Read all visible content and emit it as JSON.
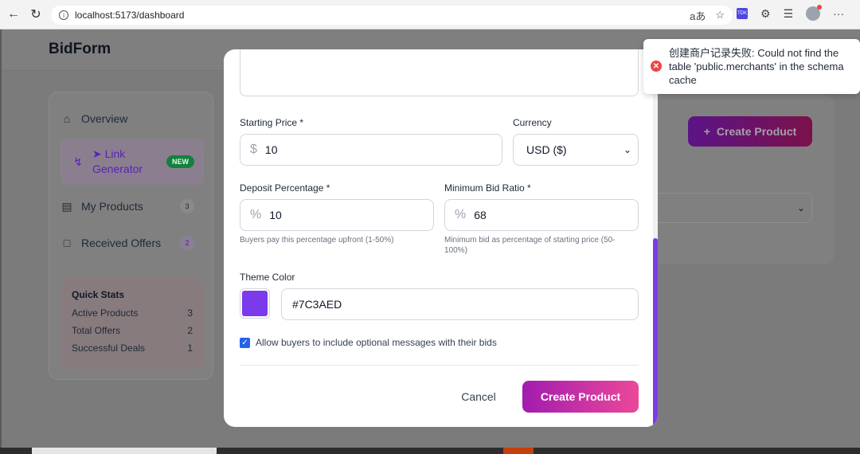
{
  "browser": {
    "url": "localhost:5173/dashboard",
    "read_aloud": "aあ",
    "ext_label": "TDK",
    "more": "···"
  },
  "app": {
    "brand": "BidForm"
  },
  "sidebar": {
    "items": [
      {
        "label": "Overview",
        "icon": "home-icon"
      },
      {
        "label": "Link Generator",
        "icon": "rocket-icon",
        "badge": "NEW",
        "active": true
      },
      {
        "label": "My Products",
        "icon": "document-icon",
        "count": "3"
      },
      {
        "label": "Received Offers",
        "icon": "chat-icon",
        "count": "2"
      }
    ],
    "link_line1": "Link",
    "link_line2": "Generator"
  },
  "quick_stats": {
    "title": "Quick Stats",
    "rows": [
      {
        "label": "Active Products",
        "value": "3"
      },
      {
        "label": "Total Offers",
        "value": "2"
      },
      {
        "label": "Successful Deals",
        "value": "1"
      }
    ]
  },
  "background": {
    "create_button": "Create Product"
  },
  "modal": {
    "starting_price": {
      "label": "Starting Price *",
      "prefix": "$",
      "value": "10"
    },
    "currency": {
      "label": "Currency",
      "value": "USD ($)"
    },
    "deposit": {
      "label": "Deposit Percentage *",
      "prefix": "%",
      "value": "10",
      "helper": "Buyers pay this percentage upfront (1-50%)"
    },
    "min_bid": {
      "label": "Minimum Bid Ratio *",
      "prefix": "%",
      "value": "68",
      "helper": "Minimum bid as percentage of starting price (50-100%)"
    },
    "theme": {
      "label": "Theme Color",
      "value": "#7C3AED",
      "color": "#7C3AED"
    },
    "allow_messages": {
      "label": "Allow buyers to include optional messages with their bids",
      "checked": true
    },
    "cancel": "Cancel",
    "submit": "Create Product"
  },
  "toast": {
    "message": "创建商户记录失败: Could not find the table 'public.merchants' in the schema cache",
    "icon": "error-icon",
    "color": "#EF4444"
  },
  "colors": {
    "accent": "#7C3AED",
    "gradient_start": "#A21CAF",
    "gradient_end": "#EC4899"
  }
}
